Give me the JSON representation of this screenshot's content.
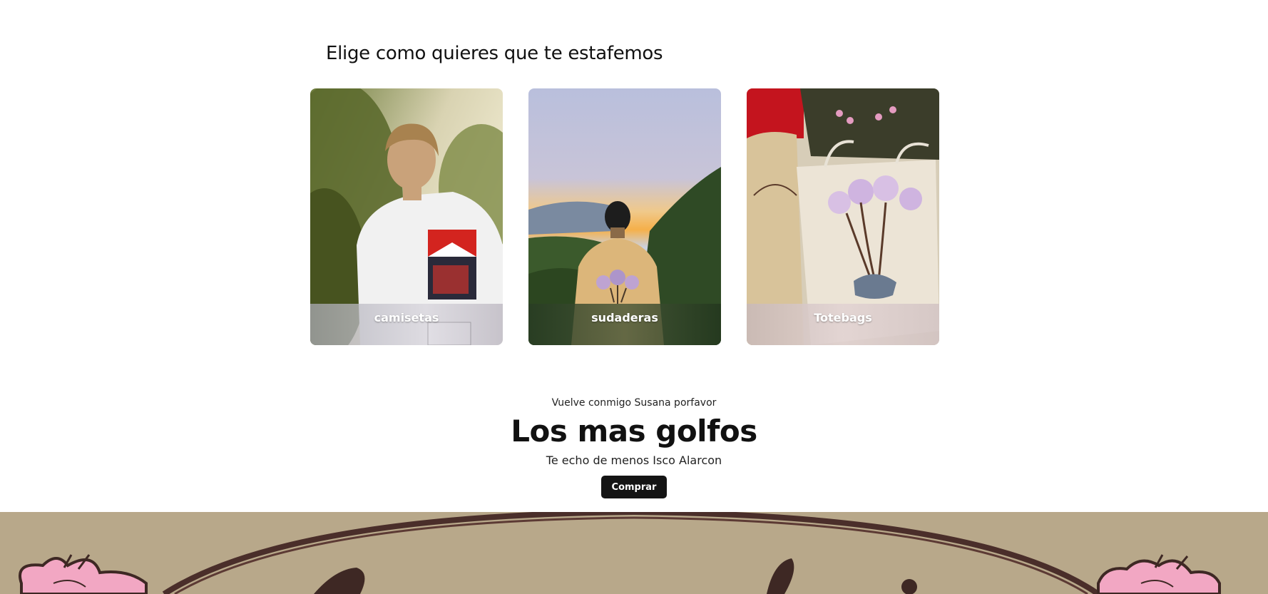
{
  "section": {
    "heading": "Elige como quieres que te estafemos"
  },
  "categories": [
    {
      "label": "camisetas"
    },
    {
      "label": "sudaderas"
    },
    {
      "label": "Totebags"
    }
  ],
  "promo": {
    "pre_title": "Vuelve conmigo Susana porfavor",
    "title": "Los mas golfos",
    "subtitle": "Te echo de menos Isco Alarcon",
    "button_label": "Comprar"
  },
  "colors": {
    "banner_bg": "#b8a88a",
    "banner_ring": "#4a2e2a",
    "flower": "#f2a7c3",
    "button_bg": "#141414"
  }
}
